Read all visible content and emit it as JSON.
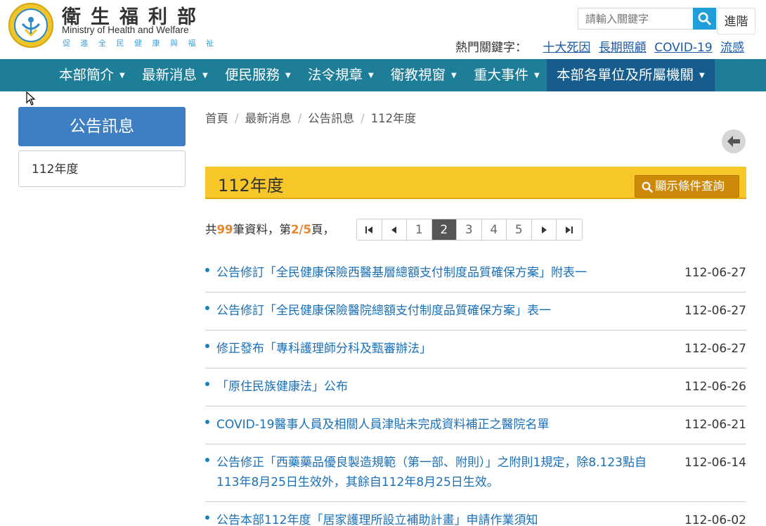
{
  "header": {
    "brand_zh": "衛生福利部",
    "brand_en": "Ministry of Health and Welfare",
    "slogan": "促進全民健康與福祉",
    "search_placeholder": "請輸入關鍵字",
    "advanced_label": "進階",
    "hot_label": "熱門關鍵字：",
    "hot_keywords": [
      "十大死因",
      "長期照顧",
      "COVID-19",
      "流感"
    ]
  },
  "nav": {
    "items": [
      {
        "label": "本部簡介"
      },
      {
        "label": "最新消息"
      },
      {
        "label": "便民服務"
      },
      {
        "label": "法令規章"
      },
      {
        "label": "衛教視窗"
      },
      {
        "label": "重大事件"
      },
      {
        "label": "本部各單位及所屬機關"
      }
    ]
  },
  "sidebar": {
    "title": "公告訊息",
    "items": [
      {
        "label": "112年度"
      }
    ]
  },
  "breadcrumb": [
    "首頁",
    "最新消息",
    "公告訊息",
    "112年度"
  ],
  "section": {
    "title": "112年度",
    "filter_label": "顯示條件查詢"
  },
  "summary": {
    "prefix": "共",
    "total": "99",
    "mid": "筆資料，第",
    "page": "2/5",
    "suffix": "頁，"
  },
  "pagination": {
    "pages": [
      "1",
      "2",
      "3",
      "4",
      "5"
    ],
    "current": "2"
  },
  "announcements": [
    {
      "title": "公告修訂「全民健康保險西醫基層總額支付制度品質確保方案」附表一",
      "date": "112-06-27"
    },
    {
      "title": "公告修訂「全民健康保險醫院總額支付制度品質確保方案」表一",
      "date": "112-06-27"
    },
    {
      "title": "修正發布「專科護理師分科及甄審辦法」",
      "date": "112-06-27"
    },
    {
      "title": "「原住民族健康法」公布",
      "date": "112-06-26"
    },
    {
      "title": "COVID-19醫事人員及相關人員津貼未完成資料補正之醫院名單",
      "date": "112-06-21"
    },
    {
      "title": "公告修正「西藥藥品優良製造規範（第一部、附則）」之附則1規定，除8.123點自113年8月25日生效外，其餘自112年8月25日生效。",
      "date": "112-06-14"
    },
    {
      "title": "公告本部112年度「居家護理所設立補助計畫」申請作業須知",
      "date": "112-06-02"
    }
  ],
  "colors": {
    "nav_bg": "#1e7e98",
    "nav_active": "#165c8c",
    "title_bar": "#f7c72a",
    "filter_btn": "#cd8a0a",
    "link": "#1a70b8",
    "highlight": "#e8862b"
  }
}
